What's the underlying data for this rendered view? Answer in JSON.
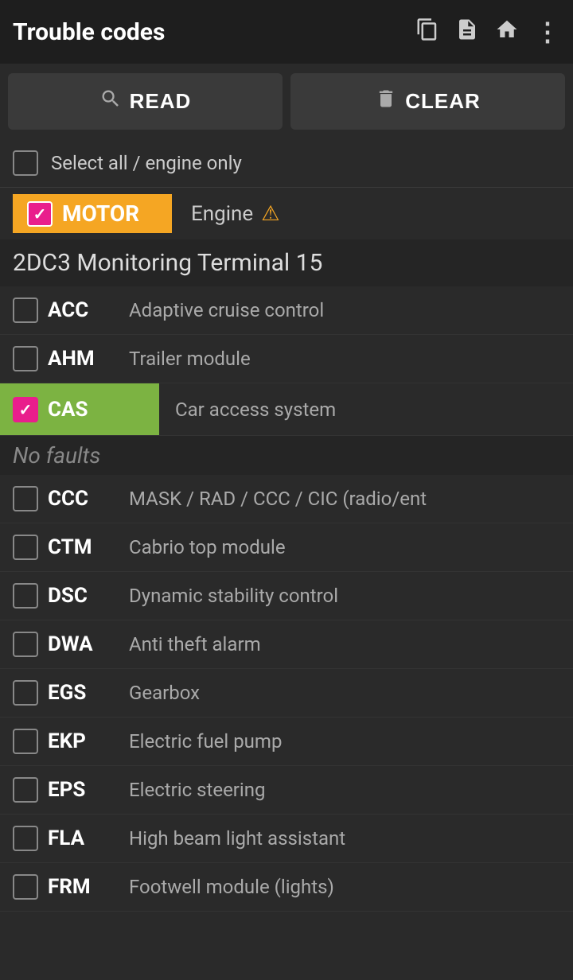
{
  "header": {
    "title": "Trouble codes",
    "icons": [
      {
        "name": "copy-icon",
        "symbol": "⧉"
      },
      {
        "name": "file-icon",
        "symbol": "📄"
      },
      {
        "name": "home-icon",
        "symbol": "🏠"
      },
      {
        "name": "more-icon",
        "symbol": "⋮"
      }
    ]
  },
  "toolbar": {
    "read_label": "READ",
    "clear_label": "CLEAR"
  },
  "select_all": {
    "label": "Select all / engine only",
    "checked": false
  },
  "motor_module": {
    "badge": "MOTOR",
    "checked": true,
    "description": "Engine",
    "has_warning": true
  },
  "section_title": "2DC3 Monitoring Terminal 15",
  "items": [
    {
      "code": "ACC",
      "description": "Adaptive cruise control",
      "checked": false,
      "highlighted": false
    },
    {
      "code": "AHM",
      "description": "Trailer module",
      "checked": false,
      "highlighted": false
    },
    {
      "code": "CAS",
      "description": "Car access system",
      "checked": true,
      "highlighted": true
    },
    {
      "code": "CCC",
      "description": "MASK / RAD / CCC / CIC (radio/ent",
      "checked": false,
      "highlighted": false
    },
    {
      "code": "CTM",
      "description": "Cabrio top module",
      "checked": false,
      "highlighted": false
    },
    {
      "code": "DSC",
      "description": "Dynamic stability control",
      "checked": false,
      "highlighted": false
    },
    {
      "code": "DWA",
      "description": "Anti theft alarm",
      "checked": false,
      "highlighted": false
    },
    {
      "code": "EGS",
      "description": "Gearbox",
      "checked": false,
      "highlighted": false
    },
    {
      "code": "EKP",
      "description": "Electric fuel pump",
      "checked": false,
      "highlighted": false
    },
    {
      "code": "EPS",
      "description": "Electric steering",
      "checked": false,
      "highlighted": false
    },
    {
      "code": "FLA",
      "description": "High beam light assistant",
      "checked": false,
      "highlighted": false
    },
    {
      "code": "FRM",
      "description": "Footwell module (lights)",
      "checked": false,
      "highlighted": false
    }
  ],
  "no_faults_label": "No faults",
  "colors": {
    "accent_orange": "#f5a623",
    "accent_green": "#7cb342",
    "accent_pink": "#e91e8c",
    "bg_dark": "#2a2a2a",
    "bg_darker": "#1e1e1e",
    "text_light": "#cccccc",
    "text_muted": "#aaaaaa"
  }
}
